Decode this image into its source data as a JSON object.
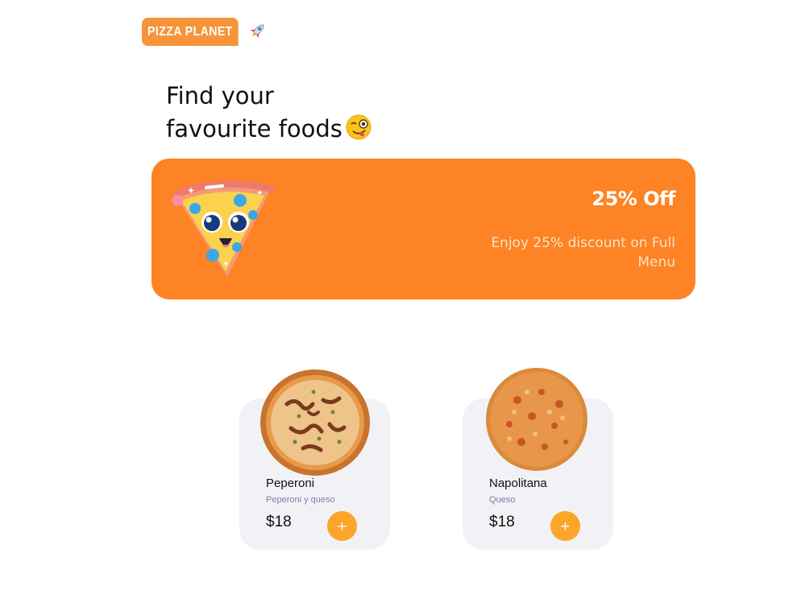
{
  "header": {
    "logo_text": "PIZZA PLANET",
    "logo_icon": "rocket-icon"
  },
  "hero": {
    "line1": "Find your",
    "line2": "favourite foods",
    "emoji": "winking-face-with-tongue-icon"
  },
  "promo": {
    "title": "25% Off",
    "text": "Enjoy 25% discount on Full Menu",
    "image": "pizza-slice-mascot-icon",
    "color": "#fd8324"
  },
  "products": [
    {
      "name": "Peperoni",
      "description": "Peperoni y queso",
      "price": "$18",
      "add_label": "+",
      "image": "pepperoni-pizza-image"
    },
    {
      "name": "Napolitana",
      "description": "Queso",
      "price": "$18",
      "add_label": "+",
      "image": "napolitana-pizza-image"
    }
  ],
  "colors": {
    "brand": "#f7943a",
    "accent_button": "#fba629",
    "card_bg": "#f2f2f6"
  }
}
